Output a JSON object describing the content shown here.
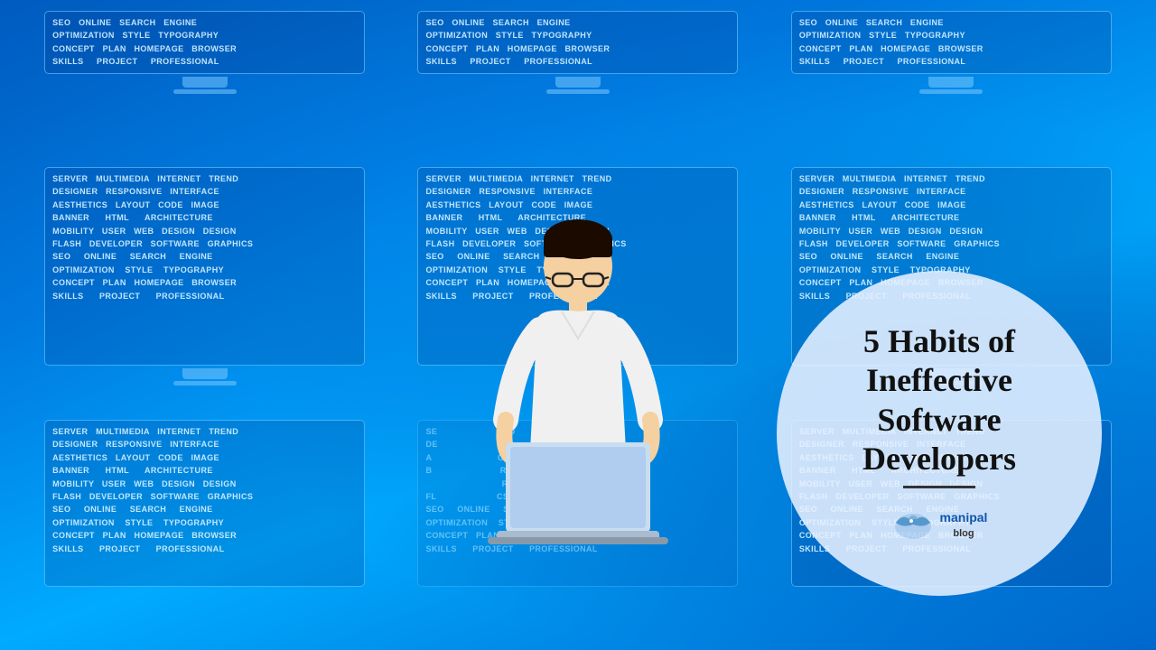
{
  "background": {
    "color1": "#0055bb",
    "color2": "#0099ff"
  },
  "wordcloud_lines": [
    "SEO   ONLINE   SEARCH   ENGINE",
    "OPTIMIZATION   STYLE   TYPOGRAPHY",
    "CONCEPT   PLAN   HOMEPAGE   BROWSER",
    "SKILLS   PROJECT   PROFESSIONAL",
    "",
    "SERVER   MULTIMEDIA   INTERNET   TREND",
    "DESIGNER   RESPONSIVE   INTERFACE",
    "AESTHETICS   LAYOUT   CODE   IMAGE",
    "BANNER      HTML      ARCHITECTURE",
    "MOBILITY  USER  WEB  DESIGN  DESIGN",
    "FLASH  DEVELOPER  SOFTWARE  GRAPHICS",
    "SEO    ONLINE    SEARCH    ENGINE",
    "OPTIMIZATION    STYLE    TYPOGRAPHY",
    "CONCEPT   PLAN   HOMEPAGE   BROWSER",
    "SKILLS      PROJECT      PROFESSIONAL"
  ],
  "title": {
    "line1": "5 Habits of",
    "line2": "Ineffective Software",
    "line3": "Developers"
  },
  "logo": {
    "name": "Manipal Blog",
    "text": "manipal",
    "suffix": "blog"
  }
}
